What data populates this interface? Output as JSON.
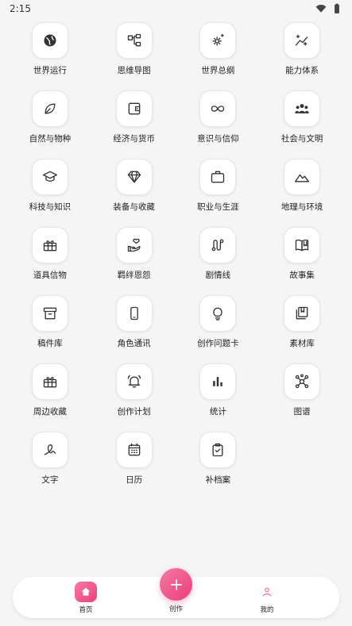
{
  "status": {
    "time": "2:15"
  },
  "grid_items": [
    {
      "label": "世界运行",
      "icon": "globe-icon"
    },
    {
      "label": "思维导图",
      "icon": "mindmap-icon"
    },
    {
      "label": "世界总纲",
      "icon": "gear-sparkle-icon"
    },
    {
      "label": "能力体系",
      "icon": "trend-sparkle-icon"
    },
    {
      "label": "自然与物种",
      "icon": "leaf-icon"
    },
    {
      "label": "经济与货币",
      "icon": "wallet-icon"
    },
    {
      "label": "意识与信仰",
      "icon": "infinity-icon"
    },
    {
      "label": "社会与文明",
      "icon": "people-icon"
    },
    {
      "label": "科技与知识",
      "icon": "graduation-cap-icon"
    },
    {
      "label": "装备与收藏",
      "icon": "diamond-icon"
    },
    {
      "label": "职业与生涯",
      "icon": "briefcase-icon"
    },
    {
      "label": "地理与环境",
      "icon": "mountain-icon"
    },
    {
      "label": "道具信物",
      "icon": "gift-box-icon"
    },
    {
      "label": "羁绊恩怨",
      "icon": "hand-heart-icon"
    },
    {
      "label": "剧情线",
      "icon": "route-icon"
    },
    {
      "label": "故事集",
      "icon": "open-book-icon"
    },
    {
      "label": "稿件库",
      "icon": "archive-icon"
    },
    {
      "label": "角色通讯",
      "icon": "phone-icon"
    },
    {
      "label": "创作问题卡",
      "icon": "lightbulb-icon"
    },
    {
      "label": "素材库",
      "icon": "library-icon"
    },
    {
      "label": "周边收藏",
      "icon": "gift-box-icon"
    },
    {
      "label": "创作计划",
      "icon": "alarm-icon"
    },
    {
      "label": "统计",
      "icon": "bar-chart-icon"
    },
    {
      "label": "图谱",
      "icon": "network-icon"
    },
    {
      "label": "文字",
      "icon": "squiggle-icon"
    },
    {
      "label": "日历",
      "icon": "calendar-icon"
    },
    {
      "label": "补档案",
      "icon": "clipboard-check-icon"
    }
  ],
  "nav": {
    "home_label": "首页",
    "create_label": "创作",
    "mine_label": "我的"
  },
  "colors": {
    "accent": "#ec3f7c",
    "background": "#f5f5f5"
  }
}
